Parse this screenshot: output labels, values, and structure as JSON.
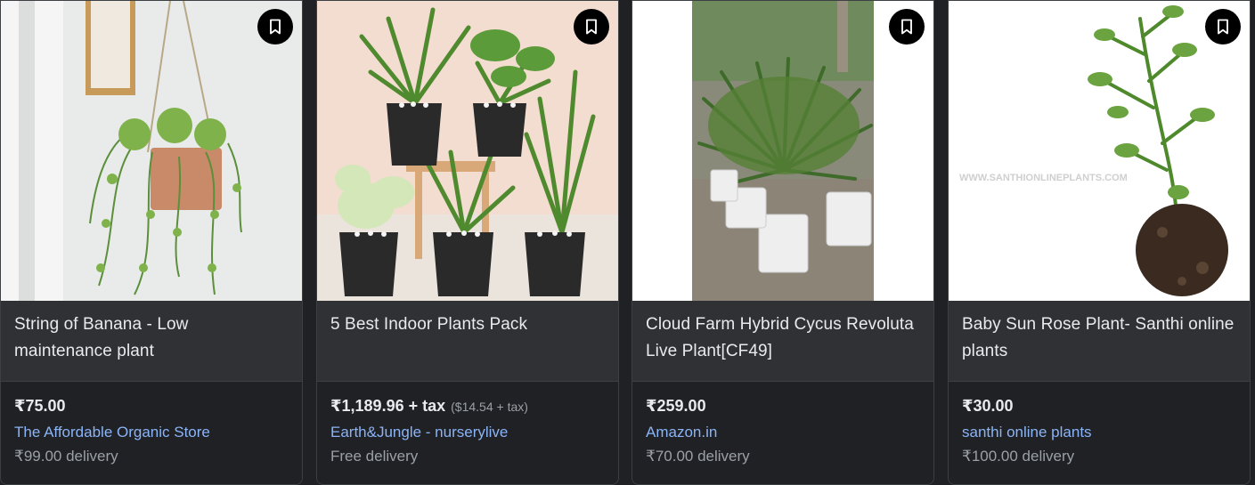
{
  "products": [
    {
      "title": "String of Banana - Low maintenance plant",
      "price": "₹75.00",
      "tax_note": "",
      "store": "The Affordable Organic Store",
      "delivery": "₹99.00 delivery"
    },
    {
      "title": "5 Best Indoor Plants Pack",
      "price": "₹1,189.96 + tax",
      "tax_note": "($14.54 + tax)",
      "store": "Earth&Jungle - nurserylive",
      "delivery": "Free delivery"
    },
    {
      "title": "Cloud Farm Hybrid Cycus Revoluta Live Plant[CF49]",
      "price": "₹259.00",
      "tax_note": "",
      "store": "Amazon.in",
      "delivery": "₹70.00 delivery"
    },
    {
      "title": "Baby Sun Rose Plant- Santhi online plants",
      "price": "₹30.00",
      "tax_note": "",
      "store": "santhi online plants",
      "delivery": "₹100.00 delivery"
    }
  ],
  "image_watermark": "WWW.SANTHIONLINEPLANTS.COM",
  "icons": {
    "save": "bookmark-icon"
  },
  "colors": {
    "background": "#202124",
    "title_bg": "#303134",
    "link": "#8ab4f8",
    "text": "#e8eaed",
    "muted": "#9aa0a6"
  }
}
